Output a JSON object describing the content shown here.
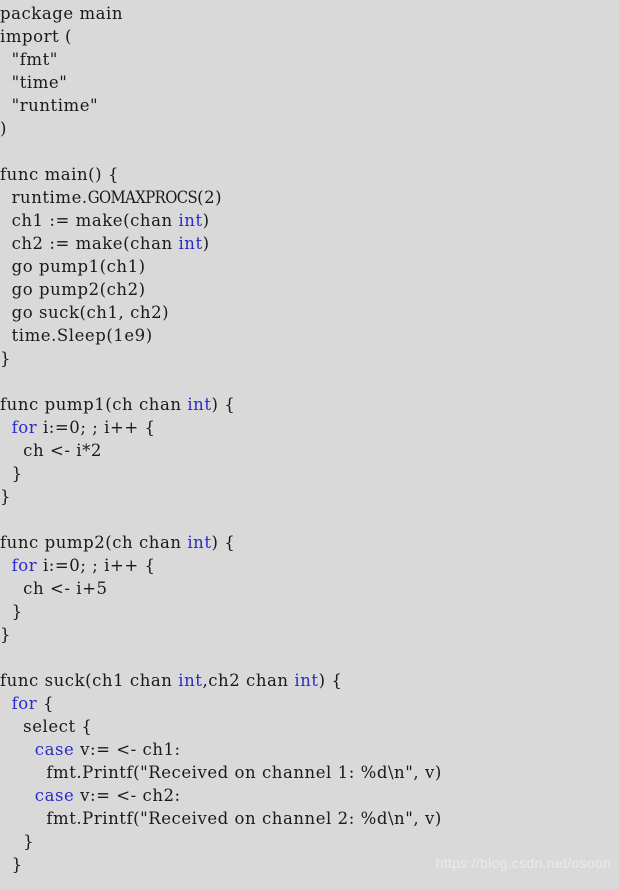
{
  "document": {
    "language": "Go",
    "background_color": "#d9d9d9",
    "text_color": "#1a1a1a",
    "keyword_color": "#2b2bc9",
    "watermark_color": "#ebebeb"
  },
  "watermark": {
    "text": "https://blog.csdn.net/osoon"
  },
  "code": {
    "lines": [
      {
        "tokens": [
          {
            "t": "package main",
            "k": "plain"
          }
        ]
      },
      {
        "tokens": [
          {
            "t": "import (",
            "k": "plain"
          }
        ]
      },
      {
        "tokens": [
          {
            "t": "  \"fmt\"",
            "k": "plain"
          }
        ]
      },
      {
        "tokens": [
          {
            "t": "  \"time\"",
            "k": "plain"
          }
        ]
      },
      {
        "tokens": [
          {
            "t": "  \"runtime\"",
            "k": "plain"
          }
        ]
      },
      {
        "tokens": [
          {
            "t": ")",
            "k": "plain"
          }
        ]
      },
      {
        "tokens": []
      },
      {
        "tokens": [
          {
            "t": "func main() {",
            "k": "plain"
          }
        ]
      },
      {
        "tokens": [
          {
            "t": "  runtime.",
            "k": "plain"
          },
          {
            "t": "GOMAXPROCS",
            "k": "caps"
          },
          {
            "t": "(2)",
            "k": "plain"
          }
        ]
      },
      {
        "tokens": [
          {
            "t": "  ch1 := make(chan ",
            "k": "plain"
          },
          {
            "t": "int",
            "k": "kw"
          },
          {
            "t": ")",
            "k": "plain"
          }
        ]
      },
      {
        "tokens": [
          {
            "t": "  ch2 := make(chan ",
            "k": "plain"
          },
          {
            "t": "int",
            "k": "kw"
          },
          {
            "t": ")",
            "k": "plain"
          }
        ]
      },
      {
        "tokens": [
          {
            "t": "  go pump1(ch1)",
            "k": "plain"
          }
        ]
      },
      {
        "tokens": [
          {
            "t": "  go pump2(ch2)",
            "k": "plain"
          }
        ]
      },
      {
        "tokens": [
          {
            "t": "  go suck(ch1, ch2)",
            "k": "plain"
          }
        ]
      },
      {
        "tokens": [
          {
            "t": "  time.Sleep(1e9)",
            "k": "plain"
          }
        ]
      },
      {
        "tokens": [
          {
            "t": "}",
            "k": "plain"
          }
        ]
      },
      {
        "tokens": []
      },
      {
        "tokens": [
          {
            "t": "func pump1(ch chan ",
            "k": "plain"
          },
          {
            "t": "int",
            "k": "kw"
          },
          {
            "t": ") {",
            "k": "plain"
          }
        ]
      },
      {
        "tokens": [
          {
            "t": "  ",
            "k": "plain"
          },
          {
            "t": "for",
            "k": "kw"
          },
          {
            "t": " i:=0; ; i++ {",
            "k": "plain"
          }
        ]
      },
      {
        "tokens": [
          {
            "t": "    ch <- i*2",
            "k": "plain"
          }
        ]
      },
      {
        "tokens": [
          {
            "t": "  }",
            "k": "plain"
          }
        ]
      },
      {
        "tokens": [
          {
            "t": "}",
            "k": "plain"
          }
        ]
      },
      {
        "tokens": []
      },
      {
        "tokens": [
          {
            "t": "func pump2(ch chan ",
            "k": "plain"
          },
          {
            "t": "int",
            "k": "kw"
          },
          {
            "t": ") {",
            "k": "plain"
          }
        ]
      },
      {
        "tokens": [
          {
            "t": "  ",
            "k": "plain"
          },
          {
            "t": "for",
            "k": "kw"
          },
          {
            "t": " i:=0; ; i++ {",
            "k": "plain"
          }
        ]
      },
      {
        "tokens": [
          {
            "t": "    ch <- i+5",
            "k": "plain"
          }
        ]
      },
      {
        "tokens": [
          {
            "t": "  }",
            "k": "plain"
          }
        ]
      },
      {
        "tokens": [
          {
            "t": "}",
            "k": "plain"
          }
        ]
      },
      {
        "tokens": []
      },
      {
        "tokens": [
          {
            "t": "func suck(ch1 chan ",
            "k": "plain"
          },
          {
            "t": "int",
            "k": "kw"
          },
          {
            "t": ",ch2 chan ",
            "k": "plain"
          },
          {
            "t": "int",
            "k": "kw"
          },
          {
            "t": ") {",
            "k": "plain"
          }
        ]
      },
      {
        "tokens": [
          {
            "t": "  ",
            "k": "plain"
          },
          {
            "t": "for",
            "k": "kw"
          },
          {
            "t": " {",
            "k": "plain"
          }
        ]
      },
      {
        "tokens": [
          {
            "t": "    select {",
            "k": "plain"
          }
        ]
      },
      {
        "tokens": [
          {
            "t": "      ",
            "k": "plain"
          },
          {
            "t": "case",
            "k": "kw"
          },
          {
            "t": " v:= <- ch1:",
            "k": "plain"
          }
        ]
      },
      {
        "tokens": [
          {
            "t": "        fmt.Printf(\"Received on channel 1: %d\\n\", v)",
            "k": "plain"
          }
        ]
      },
      {
        "tokens": [
          {
            "t": "      ",
            "k": "plain"
          },
          {
            "t": "case",
            "k": "kw"
          },
          {
            "t": " v:= <- ch2:",
            "k": "plain"
          }
        ]
      },
      {
        "tokens": [
          {
            "t": "        fmt.Printf(\"Received on channel 2: %d\\n\", v)",
            "k": "plain"
          }
        ]
      },
      {
        "tokens": [
          {
            "t": "    }",
            "k": "plain"
          }
        ]
      },
      {
        "tokens": [
          {
            "t": "  }",
            "k": "plain"
          }
        ]
      }
    ]
  }
}
